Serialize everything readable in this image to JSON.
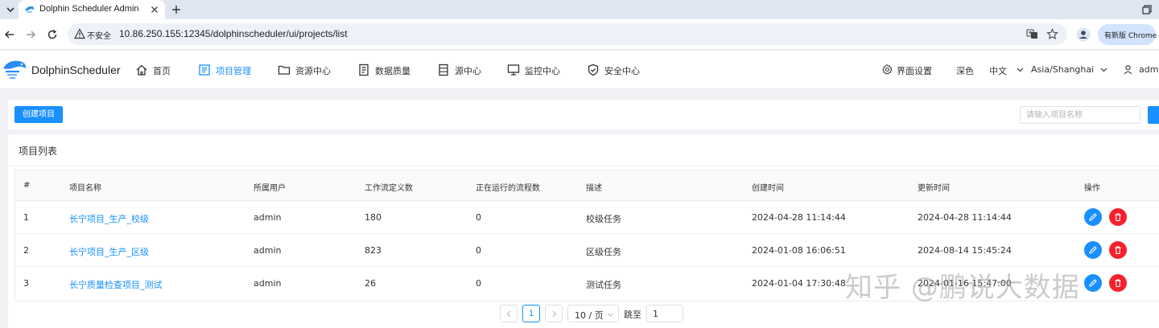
{
  "browser": {
    "tab_title": "Dolphin Scheduler Admin",
    "insecure_label": "不安全",
    "url": "10.86.250.155:12345/dolphinscheduler/ui/projects/list",
    "update_label": "有新版 Chrome"
  },
  "header": {
    "logo_text": "DolphinScheduler",
    "menu": [
      {
        "label": "首页",
        "icon": "home-icon"
      },
      {
        "label": "项目管理",
        "icon": "project-icon"
      },
      {
        "label": "资源中心",
        "icon": "folder-icon"
      },
      {
        "label": "数据质量",
        "icon": "document-icon"
      },
      {
        "label": "源中心",
        "icon": "database-icon"
      },
      {
        "label": "监控中心",
        "icon": "monitor-icon"
      },
      {
        "label": "安全中心",
        "icon": "shield-icon"
      }
    ],
    "ui_settings": "界面设置",
    "theme": "深色",
    "language": "中文",
    "timezone": "Asia/Shanghai",
    "user": "admin"
  },
  "toolbar": {
    "create_label": "创建项目",
    "search_placeholder": "请输入项目名称"
  },
  "list": {
    "title": "项目列表",
    "columns": [
      "#",
      "项目名称",
      "所属用户",
      "工作流定义数",
      "正在运行的流程数",
      "描述",
      "创建时间",
      "更新时间",
      "操作"
    ],
    "rows": [
      {
        "index": "1",
        "name": "长宁项目_生产_校级",
        "user": "admin",
        "definitions": "180",
        "running": "0",
        "desc": "校级任务",
        "created": "2024-04-28 11:14:44",
        "updated": "2024-04-28 11:14:44"
      },
      {
        "index": "2",
        "name": "长宁项目_生产_区级",
        "user": "admin",
        "definitions": "823",
        "running": "0",
        "desc": "区级任务",
        "created": "2024-01-08 16:06:51",
        "updated": "2024-08-14 15:45:24"
      },
      {
        "index": "3",
        "name": "长宁质量检查项目_测试",
        "user": "admin",
        "definitions": "26",
        "running": "0",
        "desc": "测试任务",
        "created": "2024-01-04 17:30:48",
        "updated": "2024-01-16 15:47:00"
      }
    ]
  },
  "pagination": {
    "current_page": "1",
    "page_size": "10 / 页",
    "jump_label": "跳至",
    "jump_value": "1"
  },
  "watermark": "知乎 @鹏说大数据",
  "colors": {
    "primary": "#1890ff",
    "danger": "#f5222d"
  }
}
